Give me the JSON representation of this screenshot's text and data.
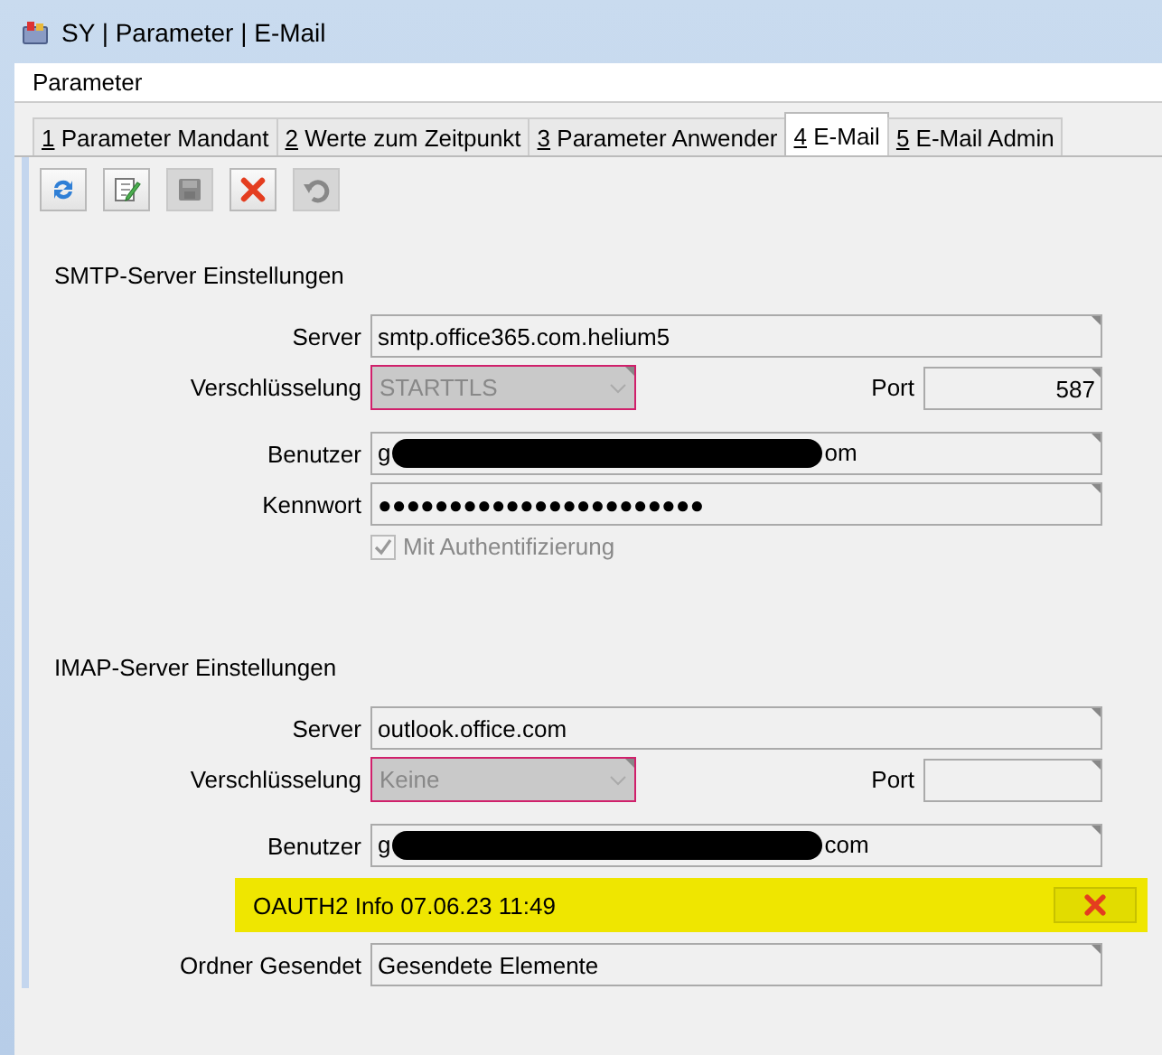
{
  "window": {
    "title": "SY | Parameter | E-Mail"
  },
  "header": "Parameter",
  "tabs": [
    {
      "key": "1",
      "label": "Parameter Mandant",
      "selected": false
    },
    {
      "key": "2",
      "label": "Werte zum Zeitpunkt",
      "selected": false
    },
    {
      "key": "3",
      "label": "Parameter Anwender",
      "selected": false
    },
    {
      "key": "4",
      "label": "E-Mail",
      "selected": true
    },
    {
      "key": "5",
      "label": "E-Mail Admin",
      "selected": false
    }
  ],
  "toolbar": [
    {
      "kind": "refresh",
      "disabled": false
    },
    {
      "kind": "edit",
      "disabled": false
    },
    {
      "kind": "save",
      "disabled": true
    },
    {
      "kind": "delete",
      "disabled": false
    },
    {
      "kind": "undo",
      "disabled": true
    }
  ],
  "sections": [
    {
      "heading": "SMTP-Server Einstellungen",
      "rows": [
        {
          "kind": "text",
          "label": "Server",
          "value": "smtp.office365.com.helium5"
        },
        {
          "kind": "combo",
          "label": "Verschlüsselung",
          "value": "STARTTLS",
          "disabled": true,
          "port_label": "Port",
          "port_value": "587"
        },
        {
          "kind": "redacted",
          "label": "Benutzer",
          "value_start": "g",
          "value_end": "om"
        },
        {
          "kind": "text",
          "label": "Kennwort",
          "value": "●●●●●●●●●●●●●●●●●●●●●●●"
        },
        {
          "kind": "checkbox",
          "label": "Mit Authentifizierung",
          "checked": true,
          "disabled": true
        }
      ]
    },
    {
      "heading": "IMAP-Server Einstellungen",
      "rows": [
        {
          "kind": "text",
          "label": "Server",
          "value": "outlook.office.com"
        },
        {
          "kind": "combo",
          "label": "Verschlüsselung",
          "value": "Keine",
          "disabled": true,
          "port_label": "Port"
        },
        {
          "kind": "redacted",
          "label": "Benutzer",
          "value_start": "g",
          "value_end": "com"
        },
        {
          "kind": "info",
          "text": "OAUTH2 Info 07.06.23 11:49",
          "highlighted": true
        },
        {
          "kind": "text",
          "label": "Ordner Gesendet",
          "value": "Gesendete Elemente"
        }
      ]
    }
  ]
}
